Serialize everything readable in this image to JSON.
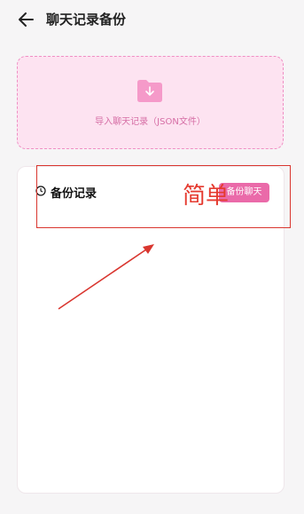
{
  "header": {
    "title": "聊天记录备份"
  },
  "import": {
    "label": "导入聊天记录（JSON文件）"
  },
  "backup": {
    "title": "备份记录",
    "button_label": "备份聊天"
  },
  "annotation": {
    "text": "简单"
  },
  "colors": {
    "accent": "#ea6aa9",
    "annotation": "#e53a2f",
    "import_bg": "#fde3f1"
  }
}
